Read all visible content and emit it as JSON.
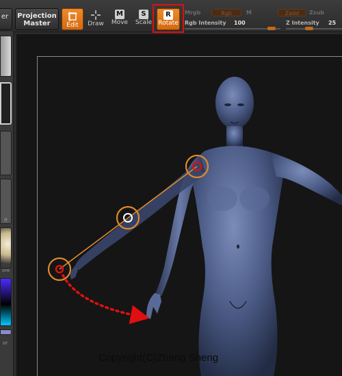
{
  "toolbar": {
    "menu_stub": "er",
    "projection_master": {
      "line1": "Projection",
      "line2": "Master"
    },
    "edit_label": "Edit",
    "draw_label": "Draw",
    "move_label": "Move",
    "move_key": "M",
    "scale_label": "Scale",
    "scale_key": "S",
    "rotate_label": "Rotate",
    "rotate_key": "R",
    "mrgb_label": "Mrgb",
    "rgb_slot": "Rgb",
    "m_label": "M",
    "zadd_slot": "Zadd",
    "zsub_label": "Zsub",
    "rgb_intensity_label": "Rgb  Intensity",
    "rgb_intensity_value": "100",
    "z_intensity_label": "Z  Intensity",
    "z_intensity_value": "25"
  },
  "left_tray": {
    "tag_off": "ff",
    "tag_ore": "ore",
    "tag_or": "or"
  },
  "canvas": {
    "copyright": "Copyright(C)Zhang Sheng"
  },
  "colors": {
    "accent_orange": "#e87a1e",
    "highlight_red": "#e01010",
    "model_blue": "#4a5a85",
    "ring_orange": "#e08a2a"
  },
  "icons": [
    "edit-icon",
    "draw-icon",
    "move-icon",
    "scale-icon",
    "rotate-icon"
  ]
}
